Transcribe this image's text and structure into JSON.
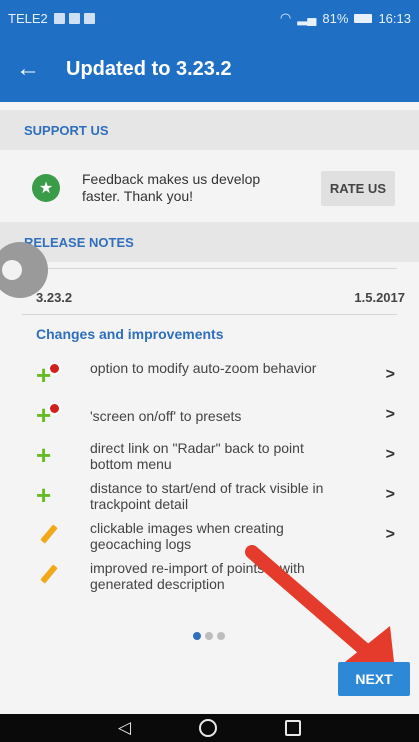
{
  "status_bar": {
    "carrier": "TELE2",
    "battery": "81%",
    "time": "16:13",
    "icons": [
      "notification-icon",
      "notification-icon",
      "notification-icon",
      "wifi-icon",
      "signal-icon",
      "battery-icon"
    ]
  },
  "app_bar": {
    "back_icon": "arrow-left-icon",
    "title": "Updated to 3.23.2"
  },
  "support": {
    "header": "SUPPORT US",
    "star_icon": "star-circle-icon",
    "feedback_text": "Feedback makes us develop faster. Thank you!",
    "rate_button": "RATE US"
  },
  "release_notes": {
    "header": "RELEASE NOTES",
    "version": "3.23.2",
    "date": "1.5.2017",
    "changes_title": "Changes and improvements",
    "items": [
      {
        "icon": "plus-pin-icon",
        "text": "option to modify auto-zoom behavior"
      },
      {
        "icon": "plus-pin-icon",
        "text": "'screen on/off' to presets"
      },
      {
        "icon": "plus-icon",
        "text": "direct link on \"Radar\" back to point bottom menu"
      },
      {
        "icon": "plus-icon",
        "text": "distance to start/end of track visible in trackpoint detail"
      },
      {
        "icon": "pencil-icon",
        "text": "clickable images when creating geocaching logs"
      },
      {
        "icon": "pencil-icon",
        "text": "improved re-import of points... with generated description"
      }
    ]
  },
  "pager": {
    "pages": 3,
    "current": 1
  },
  "next_button": "NEXT",
  "nav_bar": {
    "icons": [
      "triangle-back-icon",
      "circle-home-icon",
      "square-recent-icon"
    ]
  },
  "colors": {
    "primary": "#1f6fc4",
    "accent_blue": "#2f6fbd",
    "green": "#66bb22",
    "orange": "#f3a81a",
    "red": "#d41f1f"
  }
}
